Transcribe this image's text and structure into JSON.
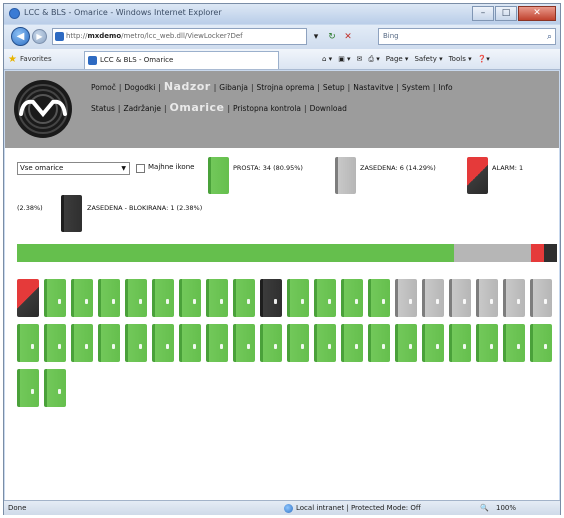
{
  "window": {
    "title": "LCC & BLS - Omarice - Windows Internet Explorer"
  },
  "browser": {
    "url_prefix": "http://",
    "url_host": "mxdemo",
    "url_rest": "/metro/lcc_web.dll/ViewLocker?Def",
    "search_placeholder": "Bing",
    "favorites_label": "Favorites",
    "tab_title": "LCC & BLS - Omarice",
    "menu": [
      "Page ▾",
      "Safety ▾",
      "Tools ▾"
    ]
  },
  "app": {
    "nav_row1": [
      "Pomoč",
      "Dogodki",
      "Nadzor",
      "Gibanja",
      "Strojna oprema",
      "Setup",
      "Nastavitve",
      "System",
      "Info"
    ],
    "nav_row2": [
      "Status",
      "Zadržanje",
      "Omarice",
      "Pristopna kontrola",
      "Download"
    ],
    "highlighted_row1": "Nadzor",
    "highlighted_row2": "Omarice"
  },
  "controls": {
    "select_value": "Vse omarice",
    "checkbox_label": "Majhne ikone",
    "legend": {
      "free_label": "PROSTA: 34 (80.95%)",
      "occupied_label": "ZASEDENA: 6 (14.29%)",
      "alarm_label": "ALARM: 1",
      "alarm_pct": "(2.38%)",
      "blocked_label": "ZASEDENA - BLOKIRANA: 1 (2.38%)"
    }
  },
  "stats": {
    "free_fraction": 0.8095,
    "occupied_fraction": 0.1429,
    "alarm_fraction": 0.0238,
    "blocked_fraction": 0.0238
  },
  "lockers": [
    "alarm",
    "free",
    "free",
    "free",
    "free",
    "free",
    "free",
    "free",
    "free",
    "blocked",
    "free",
    "free",
    "free",
    "free",
    "occupied",
    "occupied",
    "occupied",
    "occupied",
    "occupied",
    "occupied",
    "free",
    "free",
    "free",
    "free",
    "free",
    "free",
    "free",
    "free",
    "free",
    "free",
    "free",
    "free",
    "free",
    "free",
    "free",
    "free",
    "free",
    "free",
    "free",
    "free",
    "free",
    "free"
  ],
  "colors": {
    "free": "#65bf4d",
    "occupied": "#b6b6b6",
    "alarm": "#e53a3a",
    "blocked": "#2f2f2f",
    "header": "#9c9c9c"
  },
  "statusbar": {
    "left": "Done",
    "zone": "Local intranet | Protected Mode: Off",
    "zoom": "100%"
  }
}
